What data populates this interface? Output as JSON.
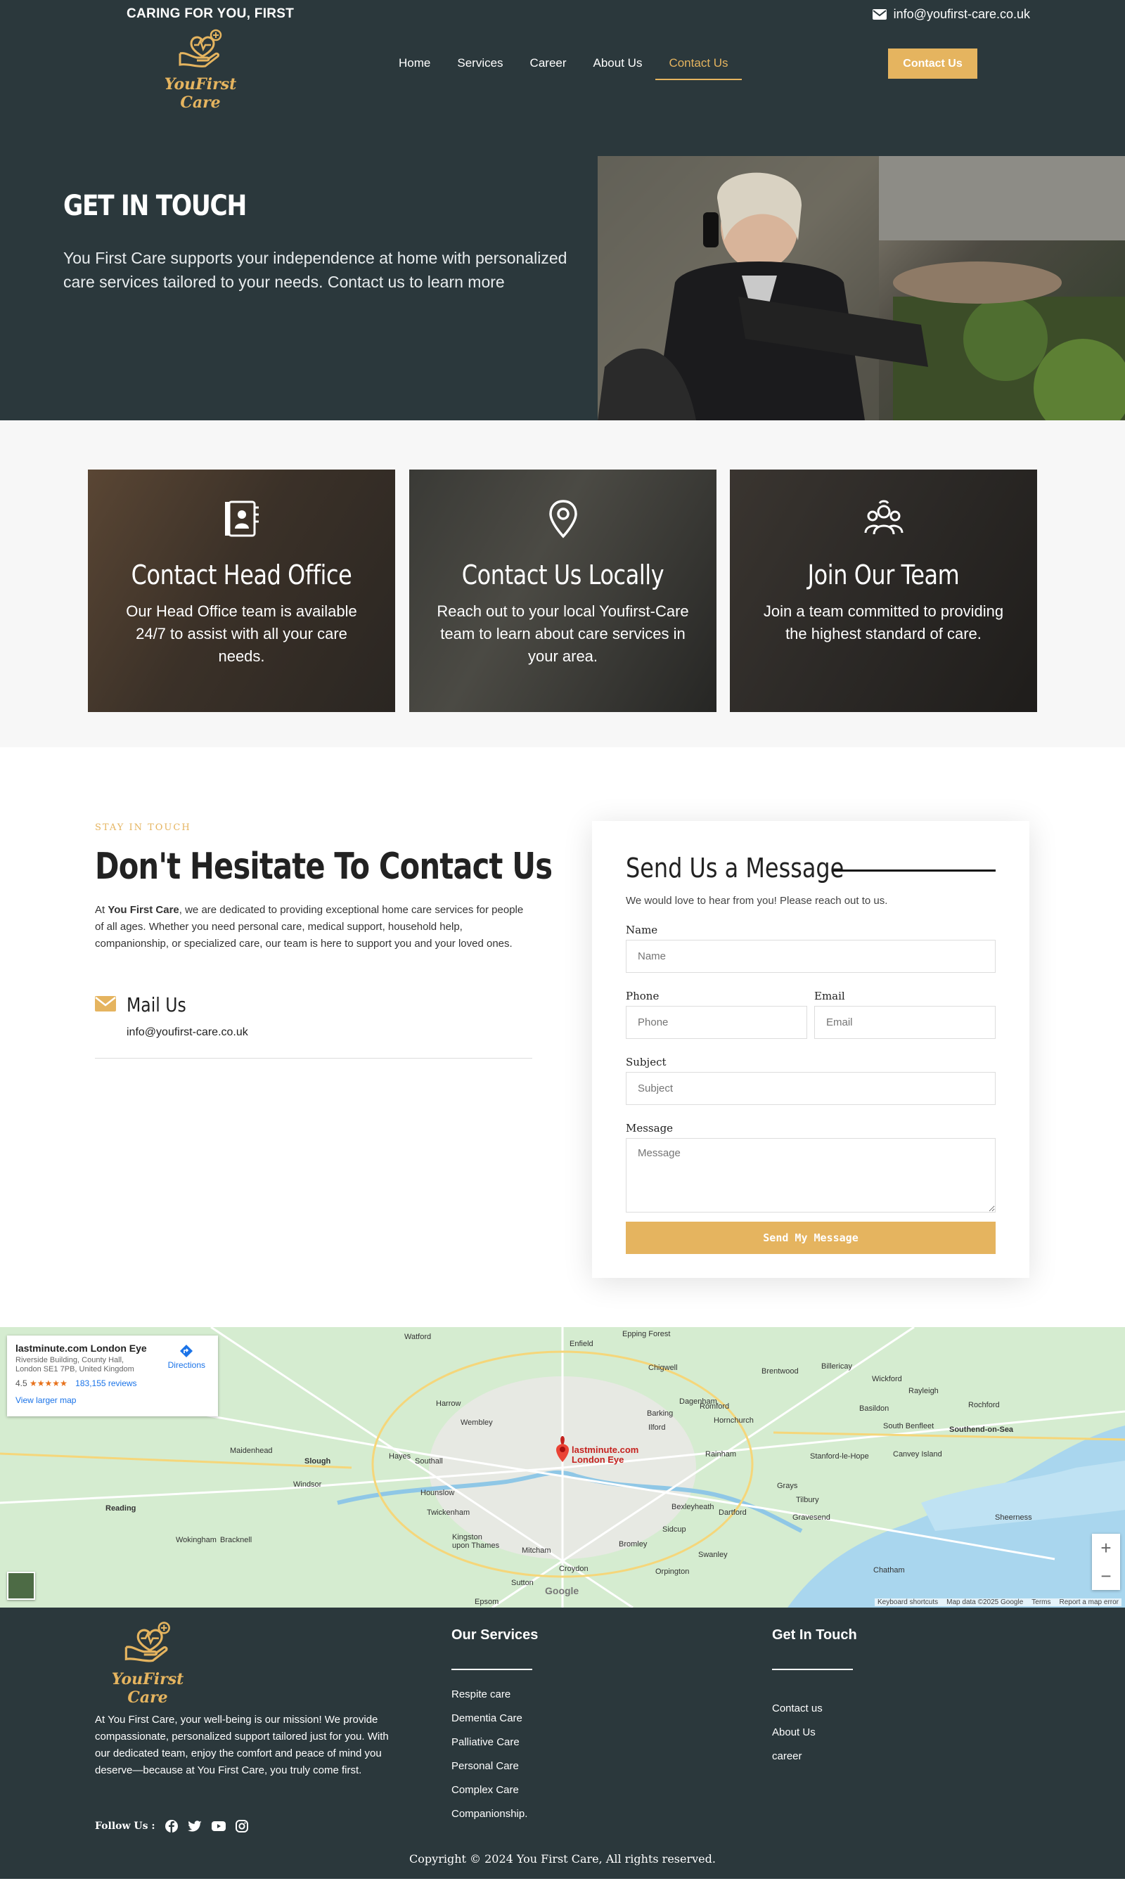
{
  "header": {
    "tagline": "CARING FOR YOU, FIRST",
    "email": "info@youfirst-care.co.uk",
    "logo_text": "YouFirst Care",
    "nav": [
      "Home",
      "Services",
      "Career",
      "About Us",
      "Contact Us"
    ],
    "active_nav": "Contact Us",
    "cta_label": "Contact Us"
  },
  "hero": {
    "title": "GET IN TOUCH",
    "text": "You First Care supports your independence at home with personalized care services tailored to your needs. Contact us to learn more"
  },
  "cards": [
    {
      "icon": "contact-book-icon",
      "title": "Contact Head Office",
      "text": "Our Head Office team is available 24/7 to assist with all your care needs."
    },
    {
      "icon": "map-pin-icon",
      "title": "Contact Us Locally",
      "text": "Reach out to your local Youfirst-Care team to learn about care services in your area."
    },
    {
      "icon": "team-icon",
      "title": "Join Our Team",
      "text": "Join a team committed to providing the highest standard of care."
    }
  ],
  "contact": {
    "eyebrow": "STAY IN TOUCH",
    "heading": "Don't Hesitate To Contact Us",
    "intro_prefix": "At ",
    "intro_brand": "You First Care",
    "intro_rest": ", we are dedicated to providing exceptional home care services for people of all ages. Whether you need personal care, medical support, household help, companionship, or specialized care, our team is here to support you and your loved ones.",
    "mail_title": "Mail Us",
    "mail_value": "info@youfirst-care.co.uk"
  },
  "form": {
    "title": "Send Us a Message",
    "subtitle": "We would love to hear from you! Please reach out to us.",
    "name_label": "Name",
    "name_placeholder": "Name",
    "phone_label": "Phone",
    "phone_placeholder": "Phone",
    "email_label": "Email",
    "email_placeholder": "Email",
    "subject_label": "Subject",
    "subject_placeholder": "Subject",
    "message_label": "Message",
    "message_placeholder": "Message",
    "submit_label": "Send My Message"
  },
  "map": {
    "place_name": "lastminute.com London Eye",
    "place_address": "Riverside Building, County Hall, London SE1 7PB, United Kingdom",
    "rating": "4.5",
    "stars": "★★★★★",
    "reviews": "183,155 reviews",
    "directions": "Directions",
    "larger_map": "View larger map",
    "marker_label_1": "lastminute.com",
    "marker_label_2": "London Eye",
    "zoom_in": "+",
    "zoom_out": "−",
    "google": "Google",
    "footer_links": [
      "Keyboard shortcuts",
      "Map data ©2025 Google",
      "Terms",
      "Report a map error"
    ],
    "labels": [
      "Watford",
      "Enfield",
      "Epping Forest",
      "Chigwell",
      "Brentwood",
      "Billericay",
      "Wickford",
      "Rayleigh",
      "Rochford",
      "Southend-on-Sea",
      "Harrow",
      "Wembley",
      "Romford",
      "Hornchurch",
      "Basildon",
      "South Benfleet",
      "Canvey Island",
      "Slough",
      "Hayes",
      "Southall",
      "Hounslow",
      "Ilford",
      "Barking",
      "Dagenham",
      "Rainham",
      "Stanford-le-Hope",
      "Grays",
      "Tilbury",
      "Gravesend",
      "Dartford",
      "Bexleyheath",
      "Sidcup",
      "Bromley",
      "Swanley",
      "Croydon",
      "Sutton",
      "Mitcham",
      "Kingston upon Thames",
      "Twickenham",
      "Reading",
      "Wokingham",
      "Bracknell",
      "Maidenhead",
      "Windsor",
      "Chatham",
      "Sheerness",
      "Orpington",
      "Epsom"
    ]
  },
  "footer": {
    "logo_text": "YouFirst Care",
    "about": "At You First Care, your well-being is our mission! We provide compassionate, personalized support tailored just for you. With our dedicated team, enjoy the comfort and peace of mind you deserve—because at You First Care, you truly come first.",
    "follow_label": "Follow Us :",
    "social_icons": [
      "facebook-icon",
      "twitter-icon",
      "youtube-icon",
      "instagram-icon"
    ],
    "services_title": "Our Services",
    "services": [
      "Respite care",
      "Dementia Care",
      "Palliative Care",
      "Personal Care",
      "Complex Care",
      "Companionship."
    ],
    "touch_title": "Get In Touch",
    "touch_links": [
      "Contact us",
      "About Us",
      "career"
    ],
    "copyright": "Copyright © 2024 You First Care, All rights reserved."
  },
  "colors": {
    "dark": "#2b383c",
    "accent": "#e5b45f"
  }
}
